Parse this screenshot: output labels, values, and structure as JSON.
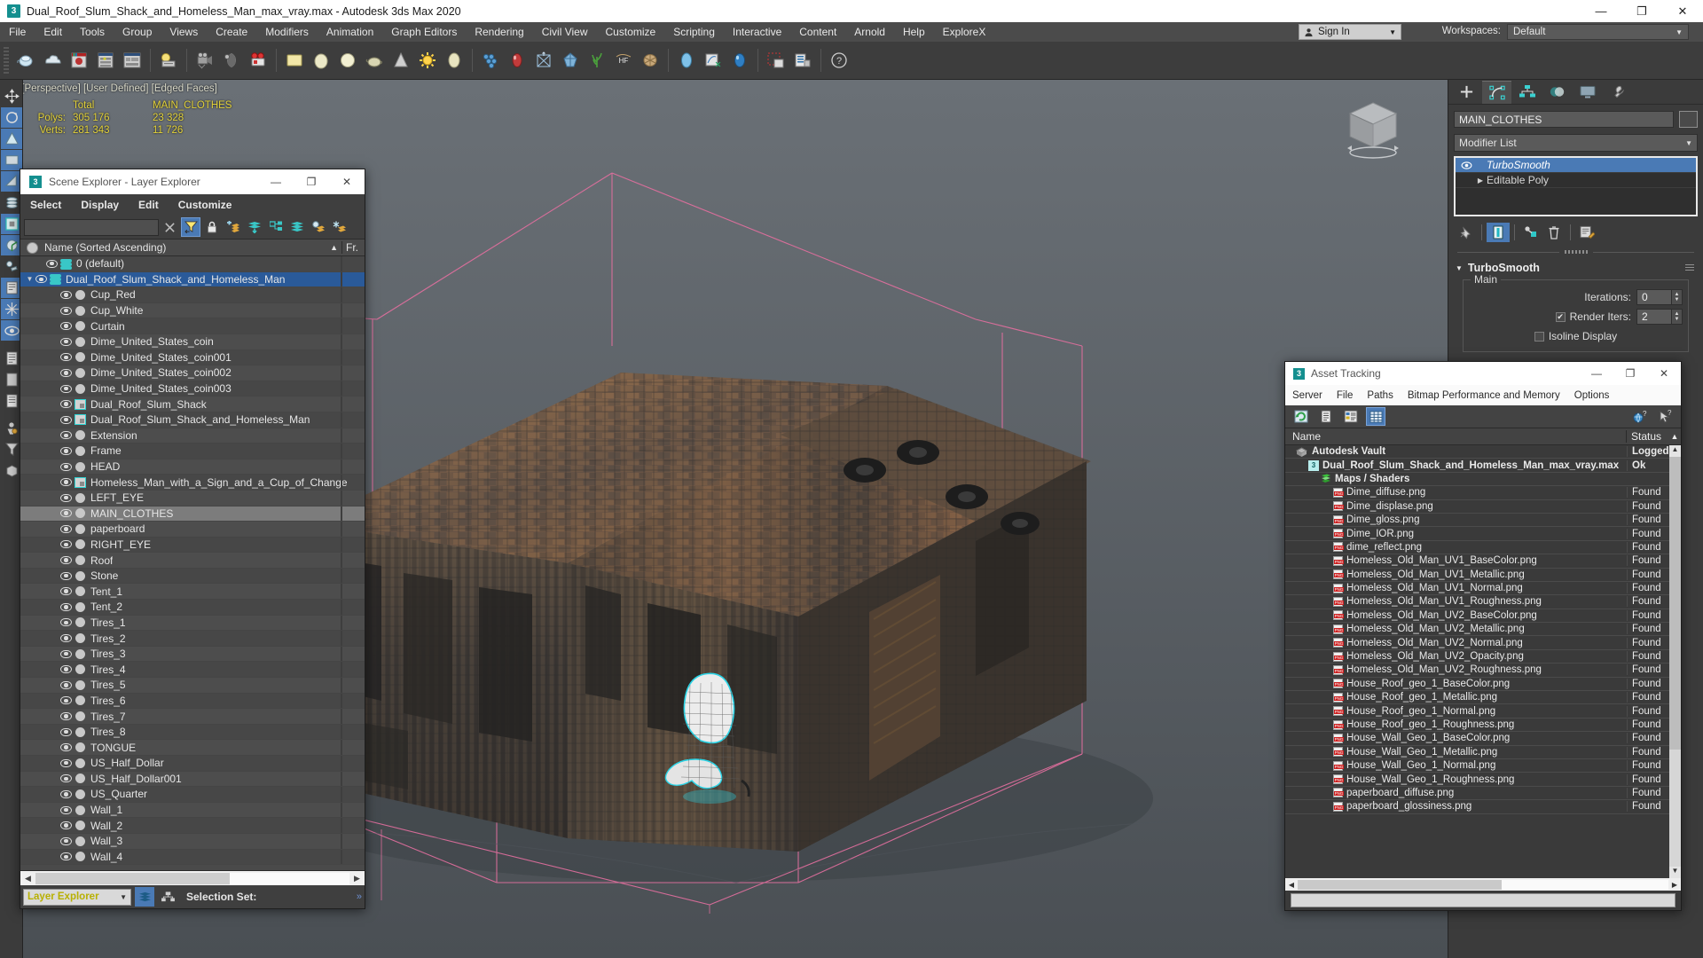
{
  "window": {
    "title": "Dual_Roof_Slum_Shack_and_Homeless_Man_max_vray.max - Autodesk 3ds Max 2020",
    "app_icon": "3",
    "minimize": "—",
    "maximize": "❐",
    "close": "✕"
  },
  "menubar": {
    "items": [
      "File",
      "Edit",
      "Tools",
      "Group",
      "Views",
      "Create",
      "Modifiers",
      "Animation",
      "Graph Editors",
      "Rendering",
      "Civil View",
      "Customize",
      "Scripting",
      "Interactive",
      "Content",
      "Arnold",
      "Help",
      "ExploreX"
    ],
    "sign_in": "Sign In",
    "workspaces_label": "Workspaces:",
    "workspace_value": "Default"
  },
  "viewport": {
    "label": "[+] [Perspective] [User Defined] [Edged Faces]",
    "stats": {
      "col_total": "Total",
      "col_object": "MAIN_CLOTHES",
      "polys_label": "Polys:",
      "polys_total": "305 176",
      "polys_object": "23 328",
      "verts_label": "Verts:",
      "verts_total": "281 343",
      "verts_object": "11 726"
    }
  },
  "scene_explorer": {
    "title": "Scene Explorer - Layer Explorer",
    "menus": [
      "Select",
      "Display",
      "Edit",
      "Customize"
    ],
    "search_placeholder": "",
    "column_name": "Name (Sorted Ascending)",
    "column_fr": "Fr.",
    "footer_combo": "Layer Explorer",
    "footer_selection_set": "Selection Set:",
    "rows": [
      {
        "label": "0 (default)",
        "indent": 28,
        "icon": "layer-stack",
        "expander": "",
        "state": "normal"
      },
      {
        "label": "Dual_Roof_Slum_Shack_and_Homeless_Man",
        "indent": 16,
        "icon": "layer-stack",
        "expander": "▼",
        "state": "selected"
      },
      {
        "label": "Cup_Red",
        "indent": 44,
        "icon": "grey-dot",
        "expander": "",
        "state": "normal"
      },
      {
        "label": "Cup_White",
        "indent": 44,
        "icon": "grey-dot",
        "expander": "",
        "state": "normal"
      },
      {
        "label": "Curtain",
        "indent": 44,
        "icon": "grey-dot",
        "expander": "",
        "state": "normal"
      },
      {
        "label": "Dime_United_States_coin",
        "indent": 44,
        "icon": "grey-dot",
        "expander": "",
        "state": "normal"
      },
      {
        "label": "Dime_United_States_coin001",
        "indent": 44,
        "icon": "grey-dot",
        "expander": "",
        "state": "normal"
      },
      {
        "label": "Dime_United_States_coin002",
        "indent": 44,
        "icon": "grey-dot",
        "expander": "",
        "state": "normal"
      },
      {
        "label": "Dime_United_States_coin003",
        "indent": 44,
        "icon": "grey-dot",
        "expander": "",
        "state": "normal"
      },
      {
        "label": "Dual_Roof_Slum_Shack",
        "indent": 44,
        "icon": "object-box",
        "expander": "",
        "state": "normal"
      },
      {
        "label": "Dual_Roof_Slum_Shack_and_Homeless_Man",
        "indent": 44,
        "icon": "object-box",
        "expander": "",
        "state": "normal"
      },
      {
        "label": "Extension",
        "indent": 44,
        "icon": "grey-dot",
        "expander": "",
        "state": "normal"
      },
      {
        "label": "Frame",
        "indent": 44,
        "icon": "grey-dot",
        "expander": "",
        "state": "normal"
      },
      {
        "label": "HEAD",
        "indent": 44,
        "icon": "grey-dot",
        "expander": "",
        "state": "normal"
      },
      {
        "label": "Homeless_Man_with_a_Sign_and_a_Cup_of_Change",
        "indent": 44,
        "icon": "object-box",
        "expander": "",
        "state": "normal"
      },
      {
        "label": "LEFT_EYE",
        "indent": 44,
        "icon": "grey-dot",
        "expander": "",
        "state": "normal"
      },
      {
        "label": "MAIN_CLOTHES",
        "indent": 44,
        "icon": "grey-dot",
        "expander": "",
        "state": "highlight"
      },
      {
        "label": "paperboard",
        "indent": 44,
        "icon": "grey-dot",
        "expander": "",
        "state": "normal"
      },
      {
        "label": "RIGHT_EYE",
        "indent": 44,
        "icon": "grey-dot",
        "expander": "",
        "state": "normal"
      },
      {
        "label": "Roof",
        "indent": 44,
        "icon": "grey-dot",
        "expander": "",
        "state": "normal"
      },
      {
        "label": "Stone",
        "indent": 44,
        "icon": "grey-dot",
        "expander": "",
        "state": "normal"
      },
      {
        "label": "Tent_1",
        "indent": 44,
        "icon": "grey-dot",
        "expander": "",
        "state": "normal"
      },
      {
        "label": "Tent_2",
        "indent": 44,
        "icon": "grey-dot",
        "expander": "",
        "state": "normal"
      },
      {
        "label": "Tires_1",
        "indent": 44,
        "icon": "grey-dot",
        "expander": "",
        "state": "normal"
      },
      {
        "label": "Tires_2",
        "indent": 44,
        "icon": "grey-dot",
        "expander": "",
        "state": "normal"
      },
      {
        "label": "Tires_3",
        "indent": 44,
        "icon": "grey-dot",
        "expander": "",
        "state": "normal"
      },
      {
        "label": "Tires_4",
        "indent": 44,
        "icon": "grey-dot",
        "expander": "",
        "state": "normal"
      },
      {
        "label": "Tires_5",
        "indent": 44,
        "icon": "grey-dot",
        "expander": "",
        "state": "normal"
      },
      {
        "label": "Tires_6",
        "indent": 44,
        "icon": "grey-dot",
        "expander": "",
        "state": "normal"
      },
      {
        "label": "Tires_7",
        "indent": 44,
        "icon": "grey-dot",
        "expander": "",
        "state": "normal"
      },
      {
        "label": "Tires_8",
        "indent": 44,
        "icon": "grey-dot",
        "expander": "",
        "state": "normal"
      },
      {
        "label": "TONGUE",
        "indent": 44,
        "icon": "grey-dot",
        "expander": "",
        "state": "normal"
      },
      {
        "label": "US_Half_Dollar",
        "indent": 44,
        "icon": "grey-dot",
        "expander": "",
        "state": "normal"
      },
      {
        "label": "US_Half_Dollar001",
        "indent": 44,
        "icon": "grey-dot",
        "expander": "",
        "state": "normal"
      },
      {
        "label": "US_Quarter",
        "indent": 44,
        "icon": "grey-dot",
        "expander": "",
        "state": "normal"
      },
      {
        "label": "Wall_1",
        "indent": 44,
        "icon": "grey-dot",
        "expander": "",
        "state": "normal"
      },
      {
        "label": "Wall_2",
        "indent": 44,
        "icon": "grey-dot",
        "expander": "",
        "state": "normal"
      },
      {
        "label": "Wall_3",
        "indent": 44,
        "icon": "grey-dot",
        "expander": "",
        "state": "normal"
      },
      {
        "label": "Wall_4",
        "indent": 44,
        "icon": "grey-dot",
        "expander": "",
        "state": "normal"
      }
    ]
  },
  "asset_tracking": {
    "title": "Asset Tracking",
    "menus": [
      "Server",
      "File",
      "Paths",
      "Bitmap Performance and Memory",
      "Options"
    ],
    "col_name": "Name",
    "col_status": "Status",
    "rows": [
      {
        "label": "Autodesk Vault",
        "status": "Logged",
        "icon": "vault",
        "indent": 12,
        "bold": true
      },
      {
        "label": "Dual_Roof_Slum_Shack_and_Homeless_Man_max_vray.max",
        "status": "Ok",
        "icon": "max",
        "indent": 26,
        "bold": true
      },
      {
        "label": "Maps / Shaders",
        "status": "",
        "icon": "maps",
        "indent": 40,
        "bold": true
      },
      {
        "label": "Dime_diffuse.png",
        "status": "Found",
        "icon": "png",
        "indent": 54,
        "bold": false
      },
      {
        "label": "Dime_displase.png",
        "status": "Found",
        "icon": "png",
        "indent": 54,
        "bold": false
      },
      {
        "label": "Dime_gloss.png",
        "status": "Found",
        "icon": "png",
        "indent": 54,
        "bold": false
      },
      {
        "label": "Dime_IOR.png",
        "status": "Found",
        "icon": "png",
        "indent": 54,
        "bold": false
      },
      {
        "label": "dime_reflect.png",
        "status": "Found",
        "icon": "png",
        "indent": 54,
        "bold": false
      },
      {
        "label": "Homeless_Old_Man_UV1_BaseColor.png",
        "status": "Found",
        "icon": "png",
        "indent": 54,
        "bold": false
      },
      {
        "label": "Homeless_Old_Man_UV1_Metallic.png",
        "status": "Found",
        "icon": "png",
        "indent": 54,
        "bold": false
      },
      {
        "label": "Homeless_Old_Man_UV1_Normal.png",
        "status": "Found",
        "icon": "png",
        "indent": 54,
        "bold": false
      },
      {
        "label": "Homeless_Old_Man_UV1_Roughness.png",
        "status": "Found",
        "icon": "png",
        "indent": 54,
        "bold": false
      },
      {
        "label": "Homeless_Old_Man_UV2_BaseColor.png",
        "status": "Found",
        "icon": "png",
        "indent": 54,
        "bold": false
      },
      {
        "label": "Homeless_Old_Man_UV2_Metallic.png",
        "status": "Found",
        "icon": "png",
        "indent": 54,
        "bold": false
      },
      {
        "label": "Homeless_Old_Man_UV2_Normal.png",
        "status": "Found",
        "icon": "png",
        "indent": 54,
        "bold": false
      },
      {
        "label": "Homeless_Old_Man_UV2_Opacity.png",
        "status": "Found",
        "icon": "png",
        "indent": 54,
        "bold": false
      },
      {
        "label": "Homeless_Old_Man_UV2_Roughness.png",
        "status": "Found",
        "icon": "png",
        "indent": 54,
        "bold": false
      },
      {
        "label": "House_Roof_geo_1_BaseColor.png",
        "status": "Found",
        "icon": "png",
        "indent": 54,
        "bold": false
      },
      {
        "label": "House_Roof_geo_1_Metallic.png",
        "status": "Found",
        "icon": "png",
        "indent": 54,
        "bold": false
      },
      {
        "label": "House_Roof_geo_1_Normal.png",
        "status": "Found",
        "icon": "png",
        "indent": 54,
        "bold": false
      },
      {
        "label": "House_Roof_geo_1_Roughness.png",
        "status": "Found",
        "icon": "png",
        "indent": 54,
        "bold": false
      },
      {
        "label": "House_Wall_Geo_1_BaseColor.png",
        "status": "Found",
        "icon": "png",
        "indent": 54,
        "bold": false
      },
      {
        "label": "House_Wall_Geo_1_Metallic.png",
        "status": "Found",
        "icon": "png",
        "indent": 54,
        "bold": false
      },
      {
        "label": "House_Wall_Geo_1_Normal.png",
        "status": "Found",
        "icon": "png",
        "indent": 54,
        "bold": false
      },
      {
        "label": "House_Wall_Geo_1_Roughness.png",
        "status": "Found",
        "icon": "png",
        "indent": 54,
        "bold": false
      },
      {
        "label": "paperboard_diffuse.png",
        "status": "Found",
        "icon": "png",
        "indent": 54,
        "bold": false
      },
      {
        "label": "paperboard_glossiness.png",
        "status": "Found",
        "icon": "png",
        "indent": 54,
        "bold": false
      }
    ]
  },
  "command_panel": {
    "object_name": "MAIN_CLOTHES",
    "modifier_list_label": "Modifier List",
    "stack": [
      {
        "label": "TurboSmooth",
        "selected": true
      },
      {
        "label": "Editable Poly",
        "selected": false
      }
    ],
    "rollout_title": "TurboSmooth",
    "group_main": "Main",
    "iterations_label": "Iterations:",
    "iterations_value": "0",
    "render_iters_label": "Render Iters:",
    "render_iters_value": "2",
    "render_iters_checked": "✔",
    "isoline_label": "Isoline Display"
  },
  "colors": {
    "accent_blue": "#4a7ab5",
    "selection_blue": "#2a5a99",
    "stat_yellow": "#e3d23a",
    "teal": "#2fd4d4",
    "gizmo_pink": "#e06a9c"
  }
}
